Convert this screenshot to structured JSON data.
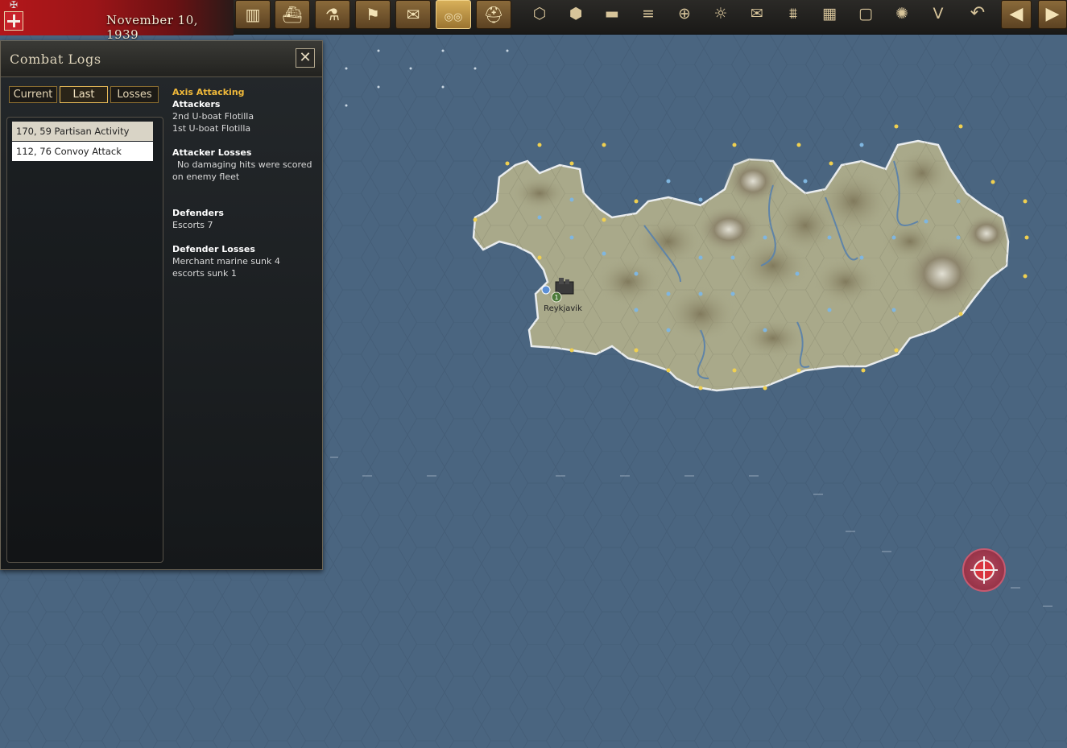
{
  "topbar": {
    "date": "November 10, 1939",
    "buttons": [
      {
        "name": "production-icon",
        "glyph": "▥"
      },
      {
        "name": "naval-icon",
        "glyph": "⛴"
      },
      {
        "name": "research-icon",
        "glyph": "⚗"
      },
      {
        "name": "diplomacy-flag-icon",
        "glyph": "⚑"
      },
      {
        "name": "reports-icon",
        "glyph": "✉"
      },
      {
        "name": "binoculars-icon",
        "glyph": "◎◎"
      },
      {
        "name": "helmet-icon",
        "glyph": "⛑"
      }
    ],
    "hex_buttons": [
      {
        "name": "hex-grid-icon",
        "glyph": "⬡"
      },
      {
        "name": "hex-cluster-icon",
        "glyph": "⬢"
      },
      {
        "name": "tank-icon",
        "glyph": "▬"
      },
      {
        "name": "resources-icon",
        "glyph": "≡"
      },
      {
        "name": "crosshair-icon",
        "glyph": "⊕"
      },
      {
        "name": "sun-icon",
        "glyph": "☼"
      },
      {
        "name": "mail-icon",
        "glyph": "✉"
      },
      {
        "name": "ship-icon",
        "glyph": "⩩"
      },
      {
        "name": "grid-icon",
        "glyph": "▦"
      },
      {
        "name": "frame-icon",
        "glyph": "▢"
      },
      {
        "name": "explosion-icon",
        "glyph": "✺"
      },
      {
        "name": "victory-icon",
        "glyph": "V"
      }
    ],
    "undo_glyph": "↶",
    "prev_glyph": "◀",
    "next_glyph": "▶"
  },
  "combat_logs": {
    "title": "Combat Logs",
    "close_glyph": "✕",
    "tabs": [
      "Current",
      "Last",
      "Losses"
    ],
    "active_tab": "Last",
    "entries": [
      "170, 59 Partisan Activity",
      "112, 76 Convoy Attack"
    ],
    "selected_entry": "170, 59 Partisan Activity",
    "detail": {
      "side": "Axis Attacking",
      "attackers_label": "Attackers",
      "attackers": [
        "2nd U-boat Flotilla",
        "1st U-boat Flotilla"
      ],
      "attacker_losses_label": "Attacker Losses",
      "attacker_losses": "No damaging hits were scored on enemy fleet",
      "defenders_label": "Defenders",
      "defenders": [
        "Escorts 7"
      ],
      "defender_losses_label": "Defender Losses",
      "defender_losses": [
        "Merchant marine sunk 4",
        "escorts sunk 1"
      ]
    }
  },
  "map": {
    "city_label": "Reykjavik",
    "unit_badge": "1",
    "colors": {
      "sea": "#4a6580",
      "land": "#a9a98a",
      "mountain": "#8a8266",
      "river": "#5f84a8"
    }
  }
}
